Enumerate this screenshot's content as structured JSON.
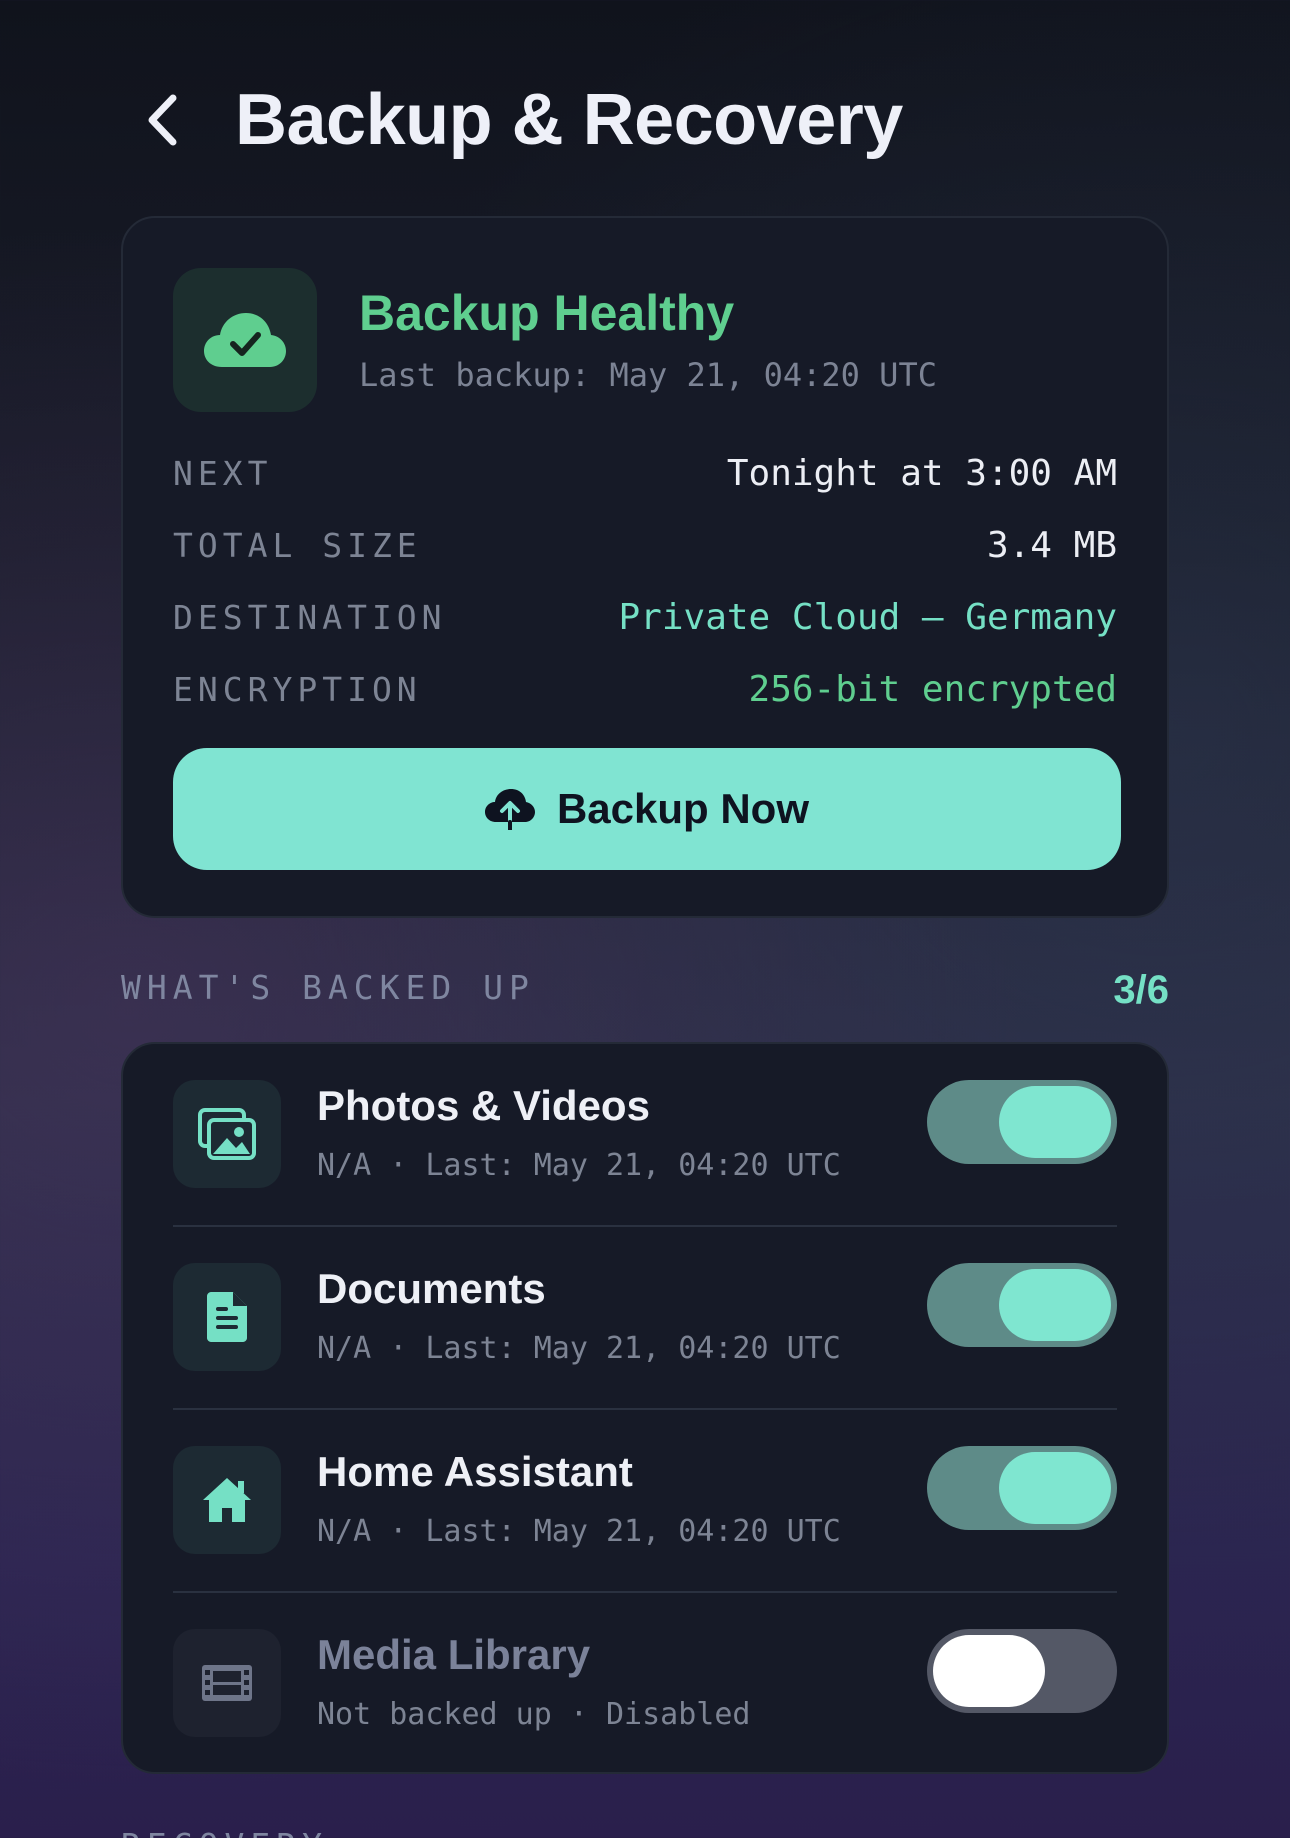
{
  "header": {
    "title": "Backup & Recovery",
    "back_icon": "chevron-left-icon"
  },
  "status": {
    "title": "Backup Healthy",
    "subtitle": "Last backup: May 21, 04:20 UTC",
    "icon": "cloud-check-icon",
    "rows": [
      {
        "key": "NEXT",
        "value": "Tonight at 3:00 AM"
      },
      {
        "key": "TOTAL SIZE",
        "value": "3.4 MB"
      },
      {
        "key": "DESTINATION",
        "value": "Private Cloud — Germany"
      },
      {
        "key": "ENCRYPTION",
        "value": "256-bit encrypted"
      }
    ],
    "button": {
      "label": "Backup Now",
      "icon": "cloud-upload-icon"
    }
  },
  "backed_up": {
    "label": "WHAT'S BACKED UP",
    "count": "3/6",
    "items": [
      {
        "name": "Photos & Videos",
        "meta": "N/A · Last: May 21, 04:20 UTC",
        "icon": "image-icon",
        "enabled": true
      },
      {
        "name": "Documents",
        "meta": "N/A · Last: May 21, 04:20 UTC",
        "icon": "document-icon",
        "enabled": true
      },
      {
        "name": "Home Assistant",
        "meta": "N/A · Last: May 21, 04:20 UTC",
        "icon": "home-icon",
        "enabled": true
      },
      {
        "name": "Media Library",
        "meta": "Not backed up · Disabled",
        "icon": "film-icon",
        "enabled": false
      }
    ]
  },
  "recovery_label": "RECOVERY",
  "colors": {
    "accent": "#80e4d2",
    "healthy": "#5fce8f",
    "card": "#161a27"
  }
}
